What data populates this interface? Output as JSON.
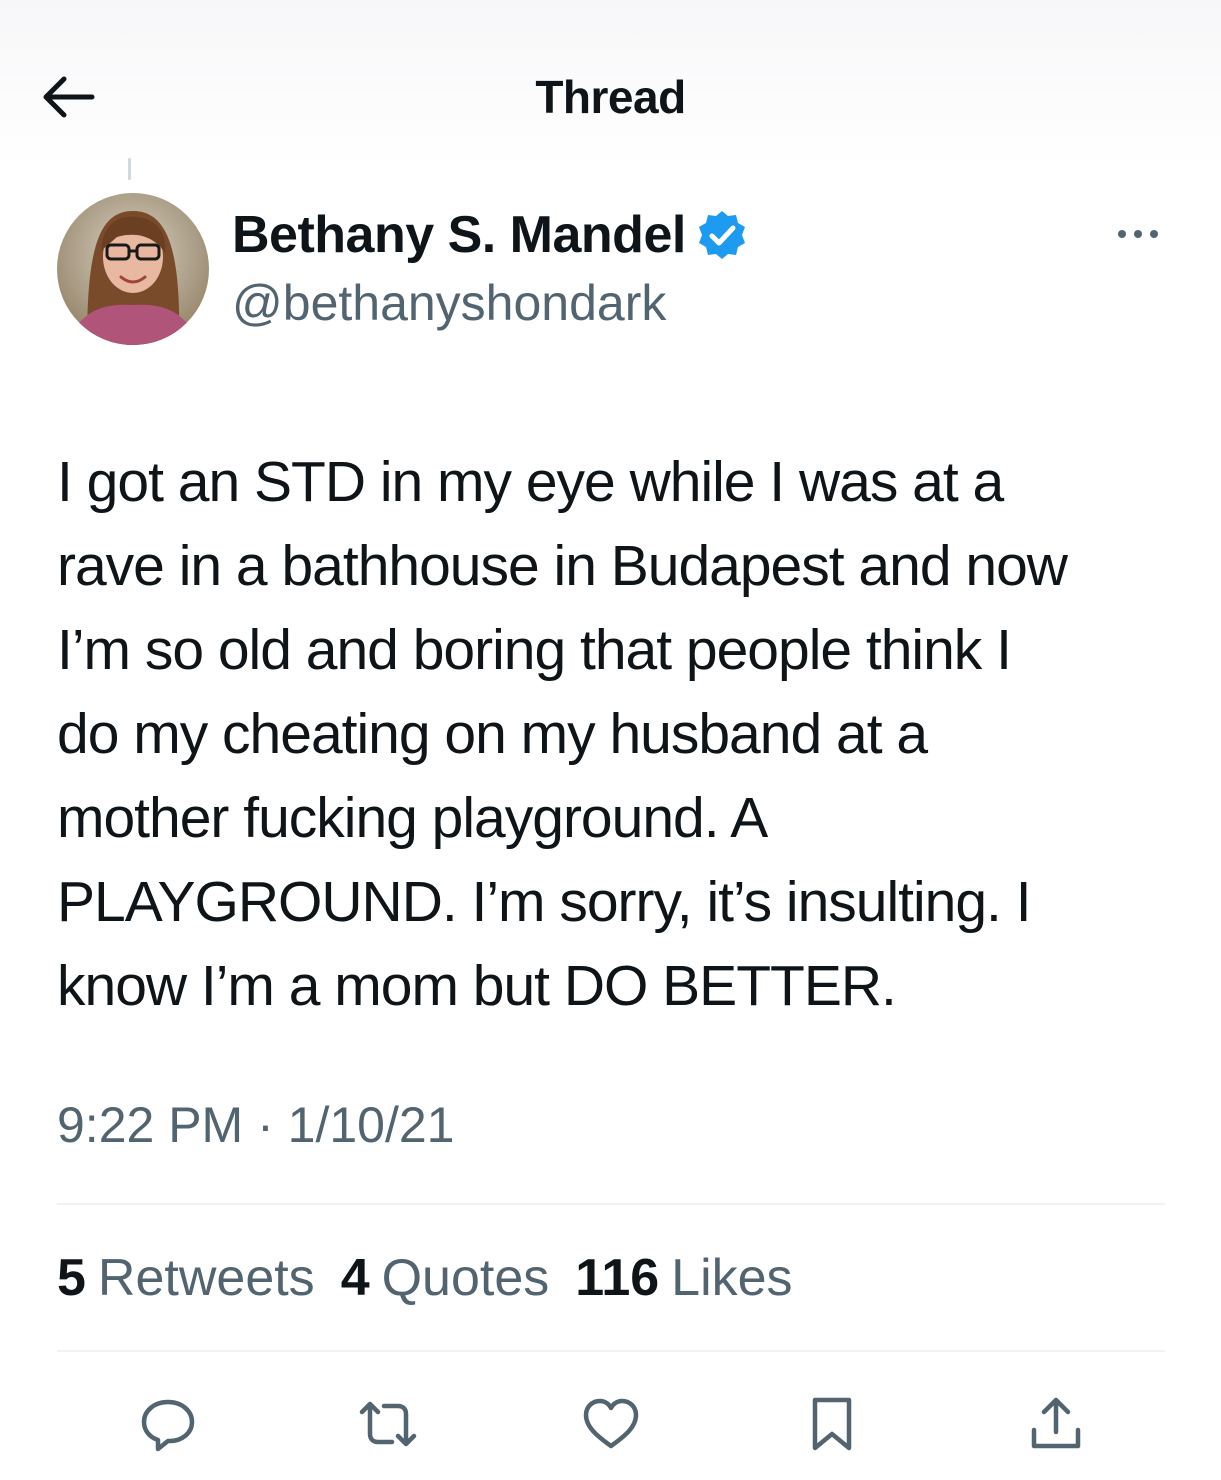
{
  "header": {
    "title": "Thread",
    "back_icon": "arrow-left-icon"
  },
  "author": {
    "display_name": "Bethany S. Mandel",
    "handle": "@bethanyshondark",
    "verified": true,
    "verified_color": "#1d9bf0"
  },
  "tweet": {
    "lines": [
      "I got an STD in my eye while I was at a",
      "rave in a bathhouse in Budapest and now",
      "I’m so old and boring that people think I",
      "do my cheating on my husband at a",
      "mother fucking playground. A",
      "PLAYGROUND. I’m sorry, it’s insulting. I",
      "know I’m a mom but DO BETTER."
    ],
    "timestamp": "9:22 PM · 1/10/21"
  },
  "stats": [
    {
      "count": "5",
      "label": "Retweets"
    },
    {
      "count": "4",
      "label": "Quotes"
    },
    {
      "count": "116",
      "label": "Likes"
    }
  ],
  "actions": [
    "reply-icon",
    "retweet-icon",
    "like-icon",
    "bookmark-icon",
    "share-icon"
  ],
  "colors": {
    "text": "#0f1419",
    "secondary": "#536471",
    "divider": "#eff3f4"
  }
}
